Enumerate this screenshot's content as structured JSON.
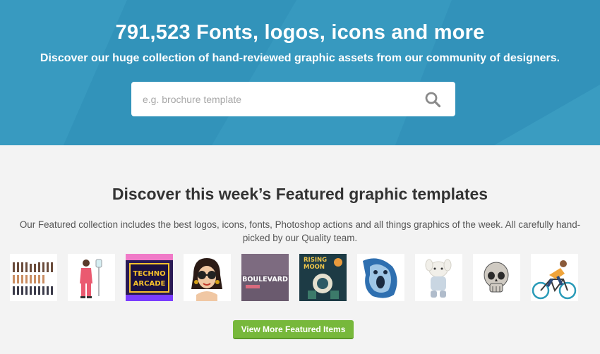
{
  "hero": {
    "title": "791,523 Fonts, logos, icons and more",
    "subtitle": "Discover our huge collection of hand-reviewed graphic assets from our community of designers.",
    "background_color": "#3596bd"
  },
  "search": {
    "placeholder": "e.g. brochure template",
    "value": "",
    "icon": "search-icon"
  },
  "featured": {
    "title": "Discover this week’s Featured graphic templates",
    "description": "Our Featured collection includes the best logos, icons, fonts, Photoshop actions and all things graphics of the week. All carefully hand-picked by our Quality team.",
    "thumbnails": [
      {
        "name": "character-creator-kit-thumbnail"
      },
      {
        "name": "nurse-illustration-thumbnail"
      },
      {
        "name": "techno-arcade-thumbnail",
        "text": "TECHNO ARCADE"
      },
      {
        "name": "woman-sunglasses-illustration-thumbnail"
      },
      {
        "name": "boulevard-font-thumbnail",
        "text": "BOULEVARD"
      },
      {
        "name": "rising-moon-thumbnail",
        "text": "RISING MOON"
      },
      {
        "name": "screaming-face-illustration-thumbnail"
      },
      {
        "name": "plush-toy-mockup-thumbnail"
      },
      {
        "name": "skull-illustration-thumbnail"
      },
      {
        "name": "cyclist-illustration-thumbnail"
      }
    ],
    "cta_label": "View More Featured Items",
    "cta_color": "#77b83b"
  }
}
